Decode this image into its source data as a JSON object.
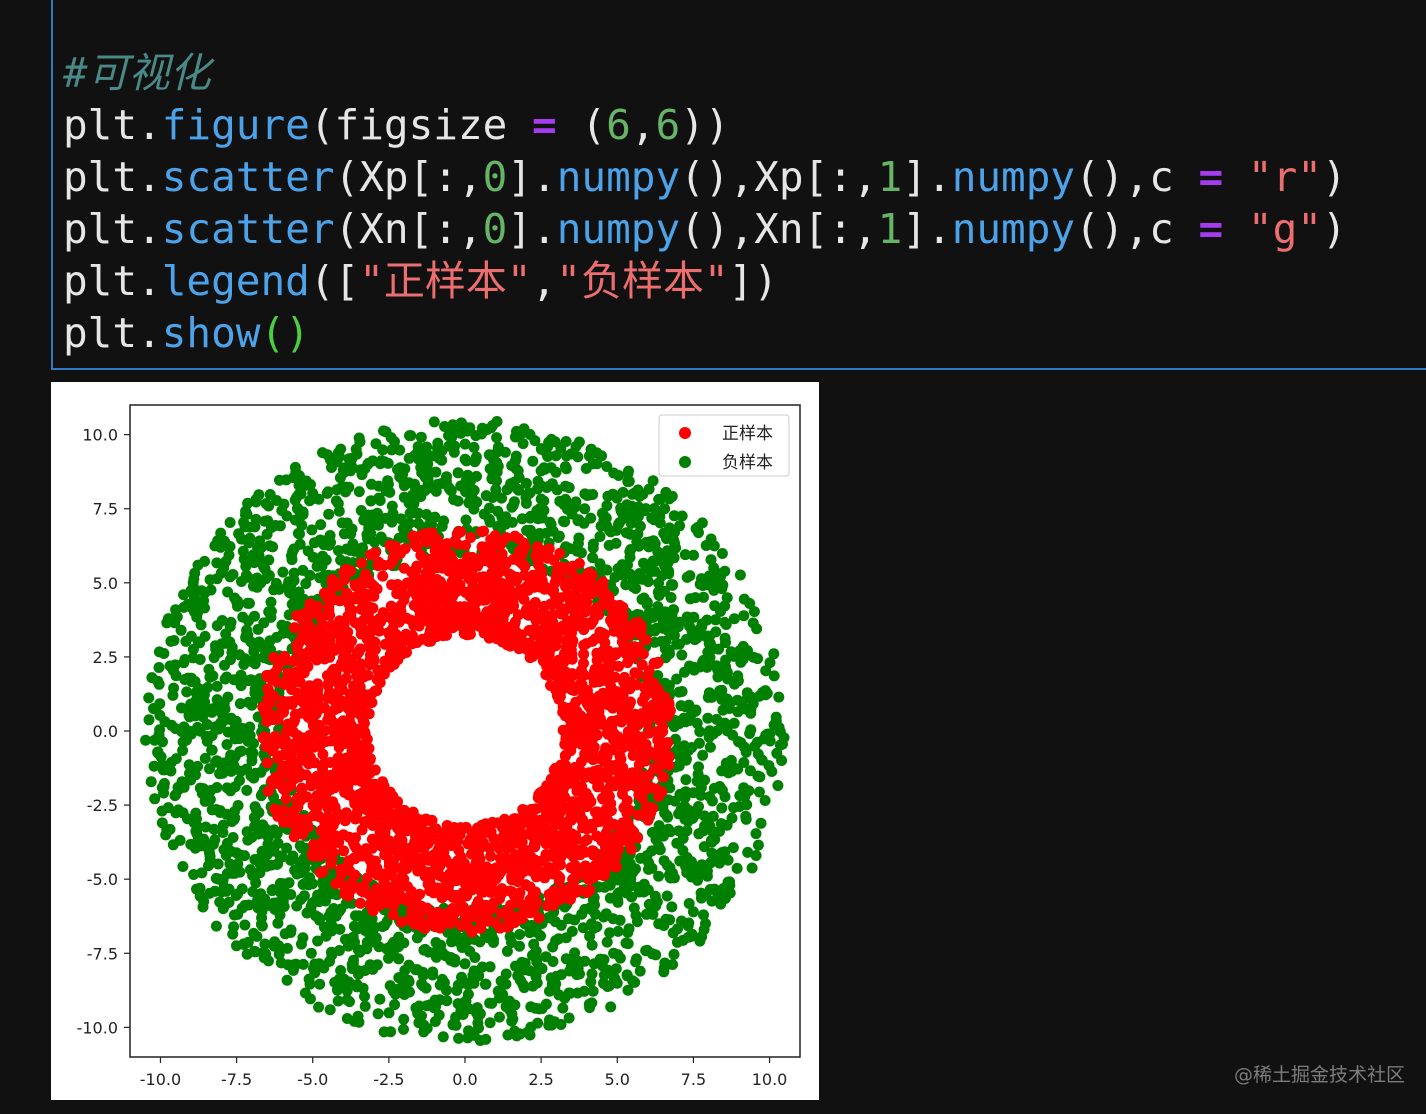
{
  "code": {
    "comment": "#可视化",
    "lines": [
      [
        [
          "plt.",
          "t"
        ],
        [
          "figure",
          "fn"
        ],
        [
          "(figsize ",
          "t"
        ],
        [
          "=",
          "op"
        ],
        [
          " (",
          "t"
        ],
        [
          "6",
          "num"
        ],
        [
          ",",
          "t"
        ],
        [
          "6",
          "num"
        ],
        [
          "))",
          "t"
        ]
      ],
      [
        [
          "plt.",
          "t"
        ],
        [
          "scatter",
          "fn"
        ],
        [
          "(Xp[:,",
          "t"
        ],
        [
          "0",
          "num"
        ],
        [
          "].",
          "t"
        ],
        [
          "numpy",
          "fn"
        ],
        [
          "(),Xp[:,",
          "t"
        ],
        [
          "1",
          "num"
        ],
        [
          "].",
          "t"
        ],
        [
          "numpy",
          "fn"
        ],
        [
          "(),c ",
          "t"
        ],
        [
          "=",
          "op"
        ],
        [
          " ",
          "t"
        ],
        [
          "\"r\"",
          "str"
        ],
        [
          ")",
          "t"
        ]
      ],
      [
        [
          "plt.",
          "t"
        ],
        [
          "scatter",
          "fn"
        ],
        [
          "(Xn[:,",
          "t"
        ],
        [
          "0",
          "num"
        ],
        [
          "].",
          "t"
        ],
        [
          "numpy",
          "fn"
        ],
        [
          "(),Xn[:,",
          "t"
        ],
        [
          "1",
          "num"
        ],
        [
          "].",
          "t"
        ],
        [
          "numpy",
          "fn"
        ],
        [
          "(),c ",
          "t"
        ],
        [
          "=",
          "op"
        ],
        [
          " ",
          "t"
        ],
        [
          "\"g\"",
          "str"
        ],
        [
          ")",
          "t"
        ]
      ],
      [
        [
          "plt.",
          "t"
        ],
        [
          "legend",
          "fn"
        ],
        [
          "([",
          "t"
        ],
        [
          "\"正样本\"",
          "str"
        ],
        [
          ",",
          "t"
        ],
        [
          "\"负样本\"",
          "str"
        ],
        [
          "])",
          "t"
        ]
      ],
      [
        [
          "plt.",
          "t"
        ],
        [
          "show",
          "fn"
        ],
        [
          "()",
          "grn"
        ]
      ]
    ]
  },
  "chart_data": {
    "type": "scatter",
    "xlim": [
      -11,
      11
    ],
    "ylim": [
      -11,
      11
    ],
    "xticks": [
      "-10.0",
      "-7.5",
      "-5.0",
      "-2.5",
      "0.0",
      "2.5",
      "5.0",
      "7.5",
      "10.0"
    ],
    "yticks": [
      "-10.0",
      "-7.5",
      "-5.0",
      "-2.5",
      "0.0",
      "2.5",
      "5.0",
      "7.5",
      "10.0"
    ],
    "legend_position": "top-right",
    "series": [
      {
        "name": "正样本",
        "color": "#ff0000",
        "r_min": 3.2,
        "r_max": 6.8
      },
      {
        "name": "负样本",
        "color": "#008000",
        "r_min": 6.0,
        "r_max": 10.5
      }
    ]
  },
  "watermark": "@稀土掘金技术社区"
}
